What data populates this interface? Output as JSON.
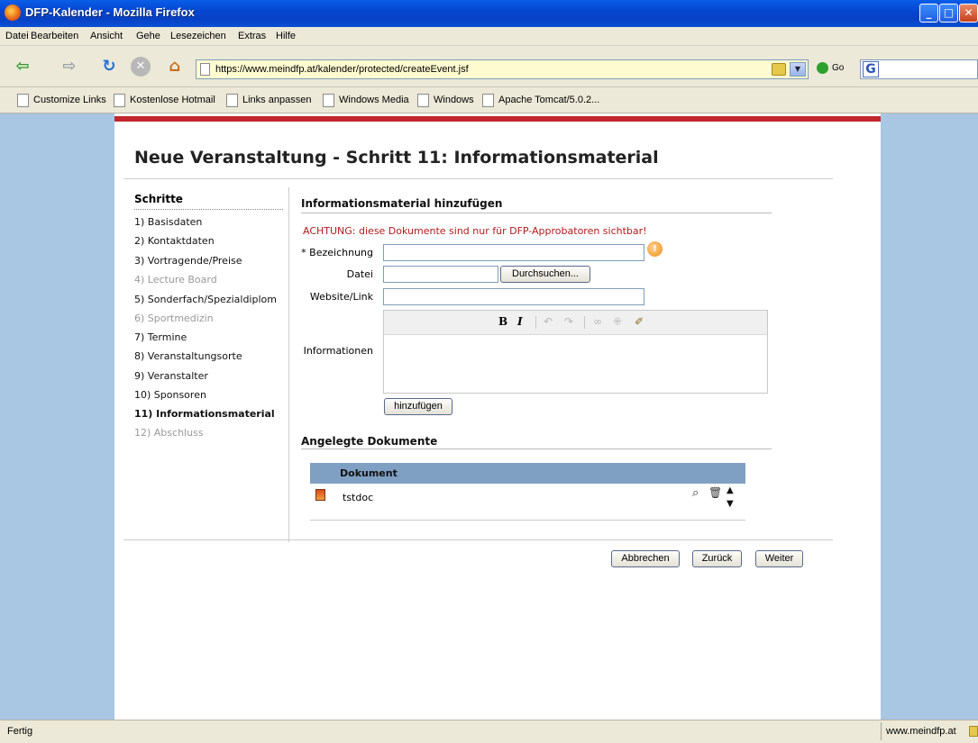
{
  "window": {
    "title": "DFP-Kalender - Mozilla Firefox",
    "min_label": "_",
    "max_label": "□",
    "close_label": "✕"
  },
  "menu": [
    "Datei",
    "Bearbeiten",
    "Ansicht",
    "Gehe",
    "Lesezeichen",
    "Extras",
    "Hilfe"
  ],
  "nav": {
    "url": "https://www.meindfp.at/kalender/protected/createEvent.jsf",
    "go_label": "Go",
    "search_logo": "G",
    "url_dropdown": "▼"
  },
  "bookmarks": [
    "Customize Links",
    "Kostenlose Hotmail",
    "Links anpassen",
    "Windows Media",
    "Windows",
    "Apache Tomcat/5.0.2..."
  ],
  "page": {
    "title": "Neue Veranstaltung - Schritt 11: Informationsmaterial",
    "steps_heading": "Schritte",
    "steps": [
      {
        "label": "1) Basisdaten",
        "state": "enabled"
      },
      {
        "label": "2) Kontaktdaten",
        "state": "enabled"
      },
      {
        "label": "3) Vortragende/Preise",
        "state": "enabled"
      },
      {
        "label": "4) Lecture Board",
        "state": "disabled"
      },
      {
        "label": "5) Sonderfach/Spezialdiplom",
        "state": "enabled"
      },
      {
        "label": "6) Sportmedizin",
        "state": "disabled"
      },
      {
        "label": "7) Termine",
        "state": "enabled"
      },
      {
        "label": "8) Veranstaltungsorte",
        "state": "enabled"
      },
      {
        "label": "9) Veranstalter",
        "state": "enabled"
      },
      {
        "label": "10) Sponsoren",
        "state": "enabled"
      },
      {
        "label": "11) Informationsmaterial",
        "state": "current"
      },
      {
        "label": "12) Abschluss",
        "state": "disabled"
      }
    ],
    "form": {
      "heading": "Informationsmaterial hinzufügen",
      "warning": "ACHTUNG: diese Dokumente sind nur für DFP-Approbatoren sichtbar!",
      "bezeichnung_label": "* Bezeichnung",
      "bezeichnung_value": "",
      "datei_label": "Datei",
      "datei_value": "",
      "browse_label": "Durchsuchen...",
      "website_label": "Website/Link",
      "website_value": "",
      "info_label": "Informationen",
      "info_value": "",
      "add_label": "hinzufügen",
      "editor_toolbar": {
        "bold": "B",
        "italic": "I",
        "undo": "↶",
        "redo": "↷",
        "link": "∞",
        "unlink": "⁜",
        "cleanup": "✐"
      }
    },
    "documents": {
      "heading": "Angelegte Dokumente",
      "column": "Dokument",
      "rows": [
        {
          "name": "tstdoc"
        }
      ],
      "view_icon": "⌕",
      "delete_icon": "🗑",
      "up_icon": "▲",
      "down_icon": "▼"
    },
    "buttons": {
      "cancel": "Abbrechen",
      "back": "Zurück",
      "next": "Weiter"
    }
  },
  "status": {
    "text": "Fertig",
    "host": "www.meindfp.at"
  }
}
